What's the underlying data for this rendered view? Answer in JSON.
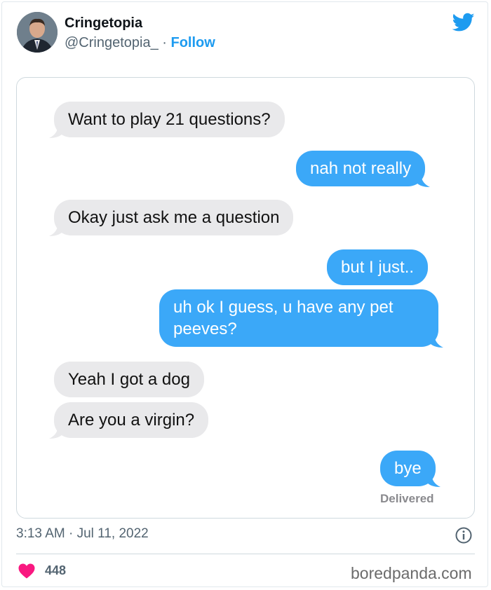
{
  "tweet": {
    "author_name": "Cringetopia",
    "handle": "@Cringetopia_",
    "separator": " · ",
    "follow_label": "Follow",
    "timestamp": "3:13 AM · Jul 11, 2022",
    "like_count": "448"
  },
  "conversation": {
    "messages": [
      {
        "from": "them",
        "text": "Want to play 21 questions?"
      },
      {
        "from": "me",
        "text": "nah not really"
      },
      {
        "from": "them",
        "text": "Okay just ask me a question"
      },
      {
        "from": "me",
        "text": "but I just.."
      },
      {
        "from": "me",
        "text": "uh ok I guess, u have any pet peeves?"
      },
      {
        "from": "them",
        "text": "Yeah I got a dog"
      },
      {
        "from": "them",
        "text": "Are you a virgin?"
      },
      {
        "from": "me",
        "text": "bye"
      }
    ],
    "status": "Delivered"
  },
  "watermark": "boredpanda.com",
  "icons": [
    "twitter-bird-icon",
    "info-icon",
    "heart-icon"
  ],
  "colors": {
    "twitter_blue": "#1d9bf0",
    "sent_bubble": "#3ba8f8",
    "received_bubble": "#e9e9eb",
    "heart": "#f91880"
  }
}
